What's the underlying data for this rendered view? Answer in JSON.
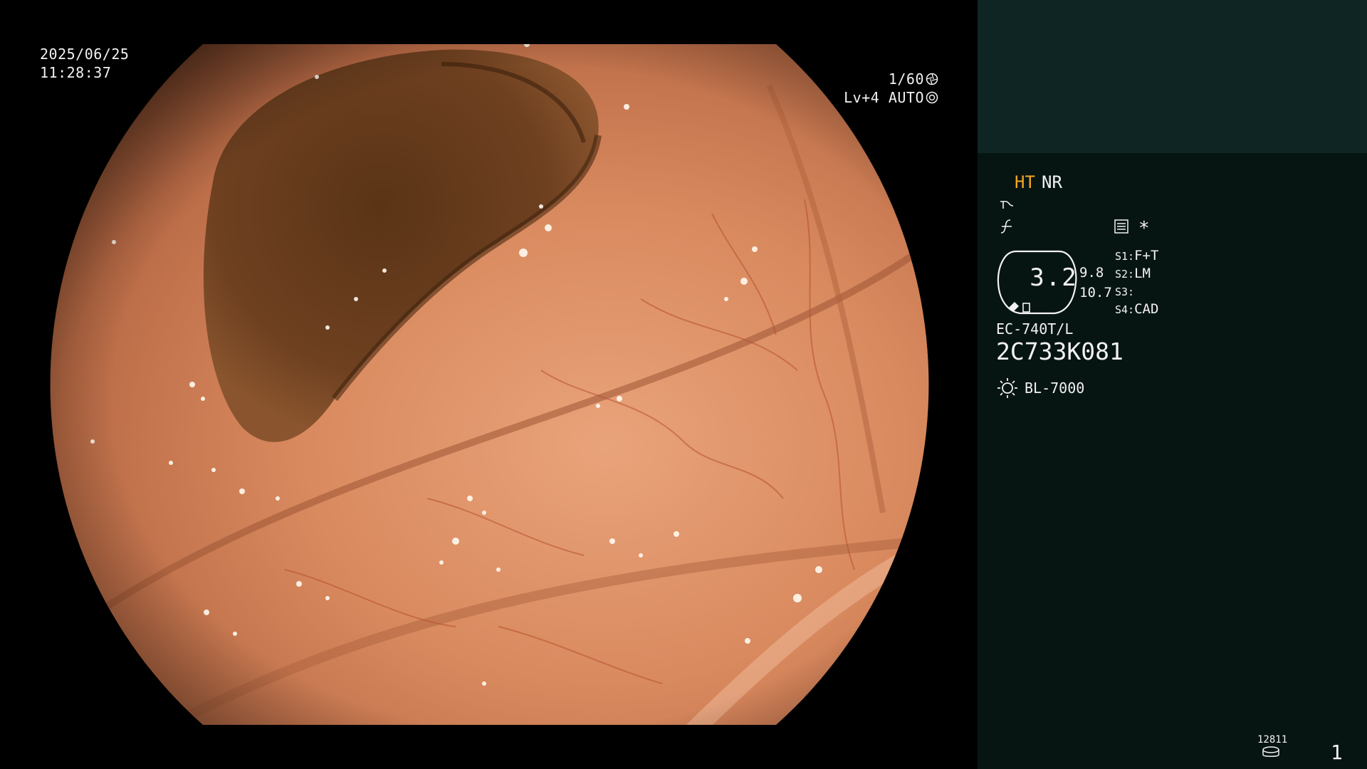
{
  "image_description_free": true,
  "overlay": {
    "date": "2025/06/25",
    "time": "11:28:37",
    "shutter": "1/60",
    "shutter_icon": "aperture-icon",
    "level": "Lv+4 AUTO",
    "level_icon": "iris-icon"
  },
  "panel": {
    "ht": "HT",
    "nr": "NR",
    "zoom": "3.2",
    "zoom_side_1": "9.8",
    "zoom_side_2": "10.7",
    "switches": [
      {
        "key": "S1:",
        "value": "F+T"
      },
      {
        "key": "S2:",
        "value": "LM"
      },
      {
        "key": "S3:",
        "value": ""
      },
      {
        "key": "S4:",
        "value": "CAD"
      }
    ],
    "asterisk": "*",
    "scope_model": "EC-740T/L",
    "scope_serial": "2C733K081",
    "light_source": "BL-7000",
    "counter": "12811",
    "page": "1"
  },
  "colors": {
    "accent_ht": "#f5a623",
    "panel_bg": "#071512",
    "panel_top_bg": "#0f2523"
  }
}
